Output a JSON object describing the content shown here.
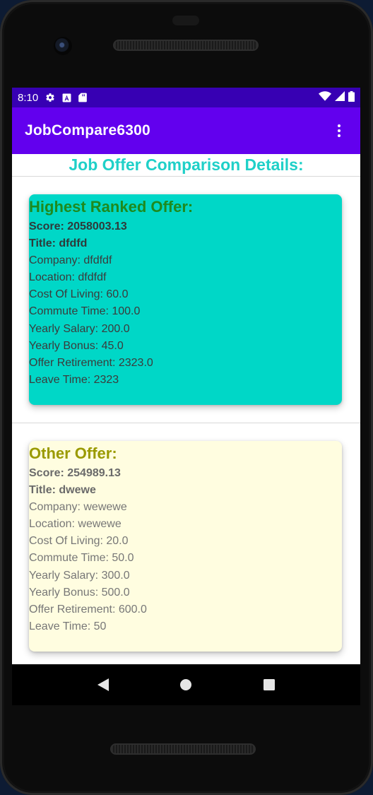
{
  "status_bar": {
    "time": "8:10",
    "icons": [
      "gear-icon",
      "a-notification-icon",
      "sd-card-icon"
    ],
    "right_icons": [
      "wifi-icon",
      "signal-icon",
      "battery-icon"
    ]
  },
  "app_bar": {
    "title": "JobCompare6300",
    "overflow_icon": "more-vert-icon"
  },
  "heading": "Job Offer Comparison Details:",
  "highest_offer": {
    "title": "Highest Ranked Offer:",
    "score": "Score: 2058003.13",
    "job_title": "Title: dfdfd",
    "company": "Company: dfdfdf",
    "location": "Location: dfdfdf",
    "cost_of_living": "Cost Of Living: 60.0",
    "commute_time": "Commute Time: 100.0",
    "yearly_salary": "Yearly Salary: 200.0",
    "yearly_bonus": "Yearly Bonus: 45.0",
    "retirement": "Offer Retirement: 2323.0",
    "leave_time": "Leave Time: 2323"
  },
  "other_offer": {
    "title": "Other Offer:",
    "score": "Score: 254989.13",
    "job_title": "Title: dwewe",
    "company": "Company: wewewe",
    "location": "Location: wewewe",
    "cost_of_living": "Cost Of Living: 20.0",
    "commute_time": "Commute Time: 50.0",
    "yearly_salary": "Yearly Salary: 300.0",
    "yearly_bonus": "Yearly Bonus: 500.0",
    "retirement": "Offer Retirement: 600.0",
    "leave_time": "Leave Time: 50"
  },
  "colors": {
    "status_bar": "#3700b3",
    "app_bar": "#6200ee",
    "heading": "#1fd0c8",
    "highest_card": "#00d7c7",
    "highest_title": "#1e8a1e",
    "other_card": "#fffde0",
    "other_title": "#9a9a00"
  },
  "nav_bar": {
    "icons": [
      "back-icon",
      "home-icon",
      "recents-icon"
    ]
  }
}
